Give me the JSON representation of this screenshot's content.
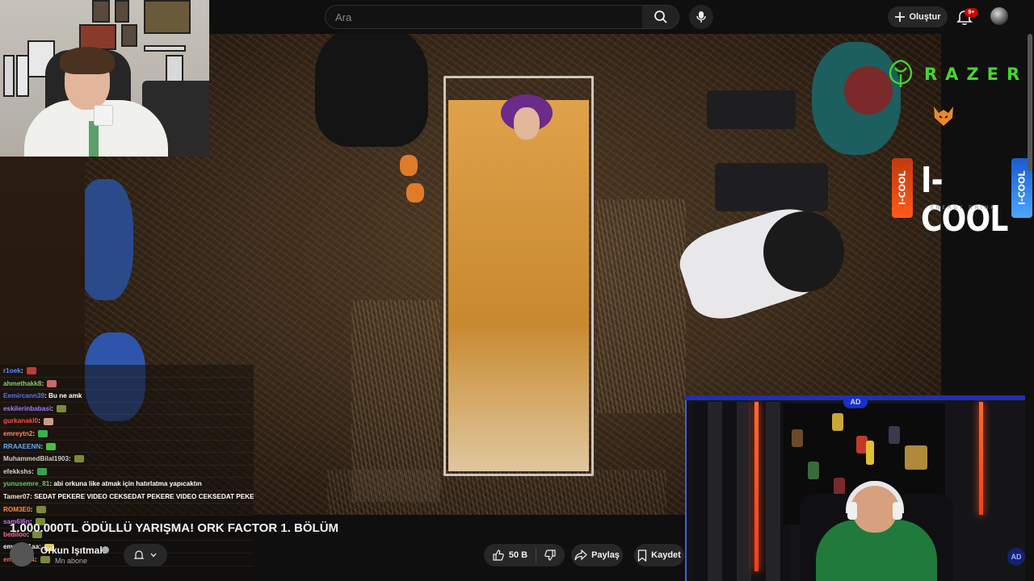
{
  "search": {
    "placeholder": "Ara"
  },
  "header": {
    "create_label": "Oluştur",
    "notifications_badge": "9+"
  },
  "video": {
    "title": "1.000.000TL ÖDÜLLÜ YARIŞMA! ORK FACTOR 1. BÖLÜM",
    "channel_name": "Orkun Işıtmak",
    "subscribers": "Mn abone",
    "likes": "50 B",
    "share_label": "Paylaş",
    "save_label": "Kaydet"
  },
  "sponsors": {
    "razer": "RAZER",
    "icool": "I-COOL",
    "icool_sub": "ENERGY DRINK",
    "can_label": "I-COOL"
  },
  "stream_badge": "AD",
  "chat": [
    {
      "user": "r1oek",
      "color": "#5b8cff",
      "msg": "",
      "emote": "#c13a3a"
    },
    {
      "user": "ahmethakk8",
      "color": "#7cd36b",
      "msg": "",
      "emote": "#c86a6a"
    },
    {
      "user": "Eemircann39",
      "color": "#4a78ff",
      "msg": "Bu ne amk",
      "emote": ""
    },
    {
      "user": "eskilerinbabasi",
      "color": "#9d7cff",
      "msg": "",
      "emote": "#7a8a3a"
    },
    {
      "user": "gurkanakl0",
      "color": "#ff4a4a",
      "msg": "",
      "emote": "#d09a8a"
    },
    {
      "user": "emreytn2",
      "color": "#ff8a5a",
      "msg": "",
      "emote": "#3ab04a"
    },
    {
      "user": "RRAAEENN",
      "color": "#5aa8ff",
      "msg": "",
      "emote": "#4ac03a"
    },
    {
      "user": "MuhammedBilal1903",
      "color": "#cccccc",
      "msg": "",
      "emote": "#7a8a3a"
    },
    {
      "user": "efekkshs",
      "color": "#d2d2d2",
      "msg": "",
      "emote": "#3aa04a"
    },
    {
      "user": "yunusemre_81",
      "color": "#5ad05a",
      "msg": "abi orkuna like atmak için hatırlatma yapıcaktın",
      "emote": ""
    },
    {
      "user": "Tamer07",
      "color": "#e8e8e8",
      "msg": "SEDAT PEKERE VIDEO CEKSEDAT PEKERE VIDEO CEKSEDAT PEKERE VIDEO CEKSEDAT PEKERE VIDEO CEKSEDAT PEKERE VIDEO CEK",
      "emote": ""
    },
    {
      "user": "ROM3E0",
      "color": "#ff8a3a",
      "msg": "",
      "emote": "#7a8a3a"
    },
    {
      "user": "sam6l6n",
      "color": "#c86aff",
      "msg": "",
      "emote": "#7a8a3a"
    },
    {
      "user": "bediloo",
      "color": "#ff6a9a",
      "msg": "",
      "emote": "#7a8a3a"
    },
    {
      "user": "emnes01aa",
      "color": "#f0f0f0",
      "msg": "",
      "emote": "#d8c86a"
    },
    {
      "user": "emrett404",
      "color": "#ff5a5a",
      "msg": "",
      "emote": "#7a8a3a"
    }
  ]
}
